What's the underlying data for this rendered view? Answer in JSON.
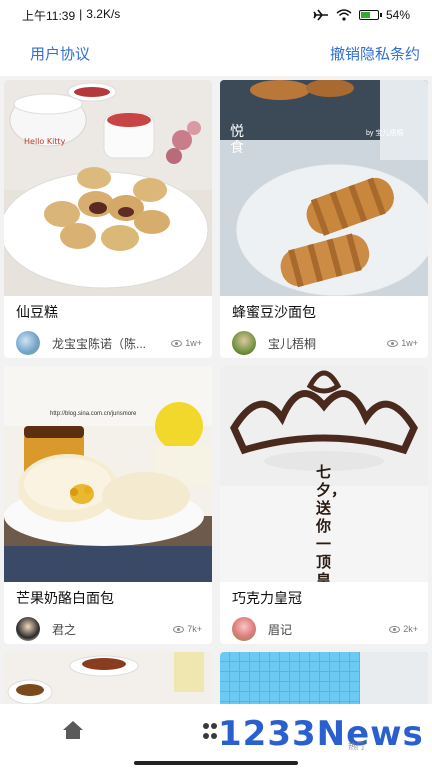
{
  "status_bar": {
    "time": "上午11:39",
    "separator": "|",
    "speed": "3.2K/s",
    "battery": "54%",
    "battery_level": 0.54
  },
  "top_nav": {
    "user_agreement": "用户协议",
    "revoke_privacy": "撤销隐私条约"
  },
  "cards": [
    {
      "title": "仙豆糕",
      "author": "龙宝宝陈诺（陈...",
      "views": "1w+"
    },
    {
      "title": "蜂蜜豆沙面包",
      "author": "宝儿梧桐",
      "views": "1w+"
    },
    {
      "title": "芒果奶酪白面包",
      "author": "君之",
      "views": "7k+"
    },
    {
      "title": "巧克力皇冠",
      "author": "眉记",
      "views": "2k+"
    }
  ],
  "image_text": {
    "photo2_logo": "悦食",
    "photo2_tag": "by 宝儿梧桐",
    "photo3_url": "http://blog.sina.com.cn/junsmore",
    "photo4_caption": "七夕，送你一顶皇冠"
  },
  "bottom_nav": {
    "watermark": "1233News",
    "watermark_sub": "热门"
  },
  "colors": {
    "accent": "#2f6fd6",
    "watermark": "#2a5fd0"
  }
}
